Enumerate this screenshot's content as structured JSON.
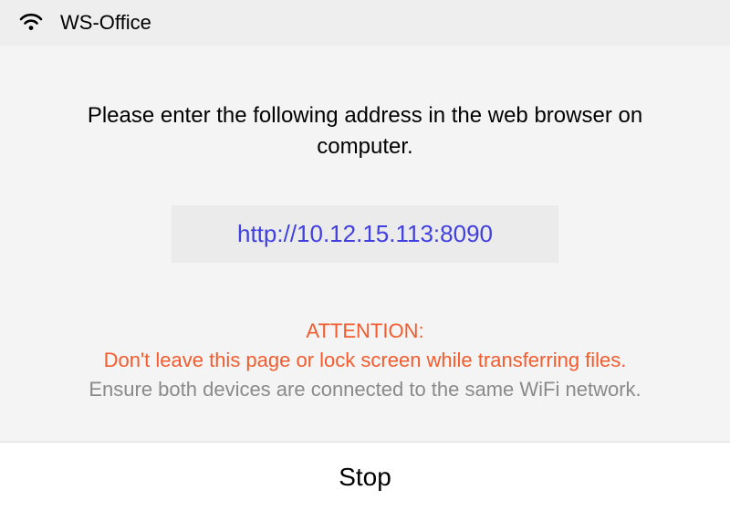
{
  "status_bar": {
    "network_name": "WS-Office"
  },
  "main": {
    "instruction": "Please enter the following address in the web browser on computer.",
    "url": "http://10.12.15.113:8090",
    "attention_label": "ATTENTION:",
    "warning": "Don't leave this page or lock screen while transferring files.",
    "info": "Ensure both devices are connected to the same WiFi network."
  },
  "bottom": {
    "stop_label": "Stop"
  }
}
